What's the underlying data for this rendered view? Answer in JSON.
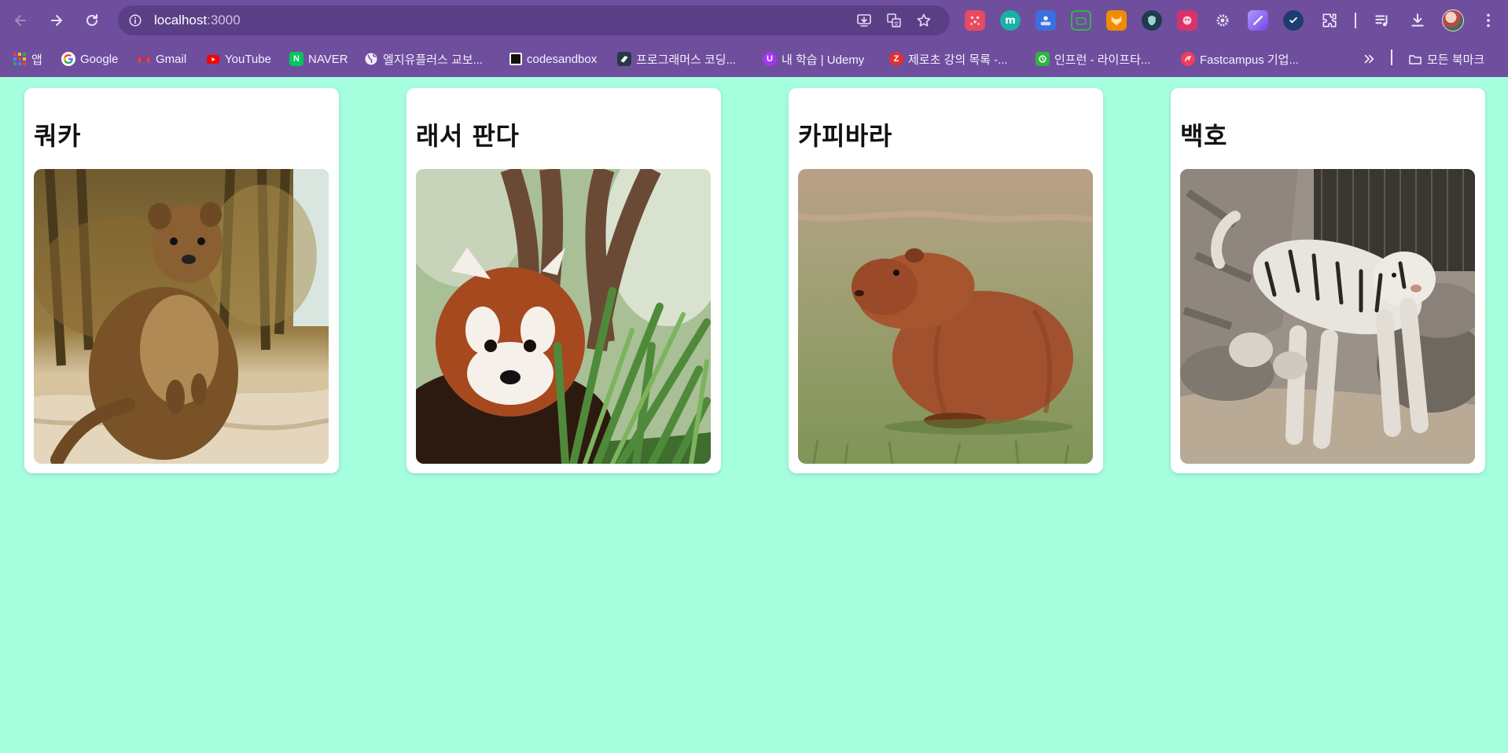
{
  "browser": {
    "url_host": "localhost",
    "url_port": ":3000",
    "icons": [
      "back-icon",
      "forward-icon",
      "reload-icon",
      "site-info-icon",
      "install-app-icon",
      "translate-icon",
      "bookmark-star-icon",
      "extensions-icon",
      "media-control-icon",
      "download-icon",
      "more-menu-icon"
    ],
    "extension_labels": {
      "m": "m"
    },
    "theme_color": "#6f4e9e"
  },
  "bookmarks": {
    "items": [
      {
        "label": "앱",
        "icon": "apps-grid-icon"
      },
      {
        "label": "Google",
        "icon": "google-icon"
      },
      {
        "label": "Gmail",
        "icon": "gmail-icon"
      },
      {
        "label": "YouTube",
        "icon": "youtube-icon"
      },
      {
        "label": "NAVER",
        "icon": "naver-icon",
        "glyph": "N"
      },
      {
        "label": "엘지유플러스 교보...",
        "icon": "globe-icon"
      },
      {
        "label": "codesandbox",
        "icon": "codesandbox-icon"
      },
      {
        "label": "프로그래머스 코딩...",
        "icon": "programmers-icon"
      },
      {
        "label": "내 학습 | Udemy",
        "icon": "udemy-icon",
        "glyph": "U"
      },
      {
        "label": "제로초 강의 목록 -...",
        "icon": "zerocho-icon",
        "glyph": "Z"
      },
      {
        "label": "인프런 - 라이프타...",
        "icon": "inflearn-icon"
      },
      {
        "label": "Fastcampus 기업...",
        "icon": "fastcampus-icon"
      }
    ],
    "all_bookmarks_label": "모든 북마크"
  },
  "page": {
    "background_color": "#a5fede",
    "cards": [
      {
        "title": "쿼카",
        "image": "quokka-photo"
      },
      {
        "title": "래서 판다",
        "image": "red-panda-photo"
      },
      {
        "title": "카피바라",
        "image": "capybara-photo"
      },
      {
        "title": "백호",
        "image": "white-tiger-photo"
      }
    ]
  }
}
